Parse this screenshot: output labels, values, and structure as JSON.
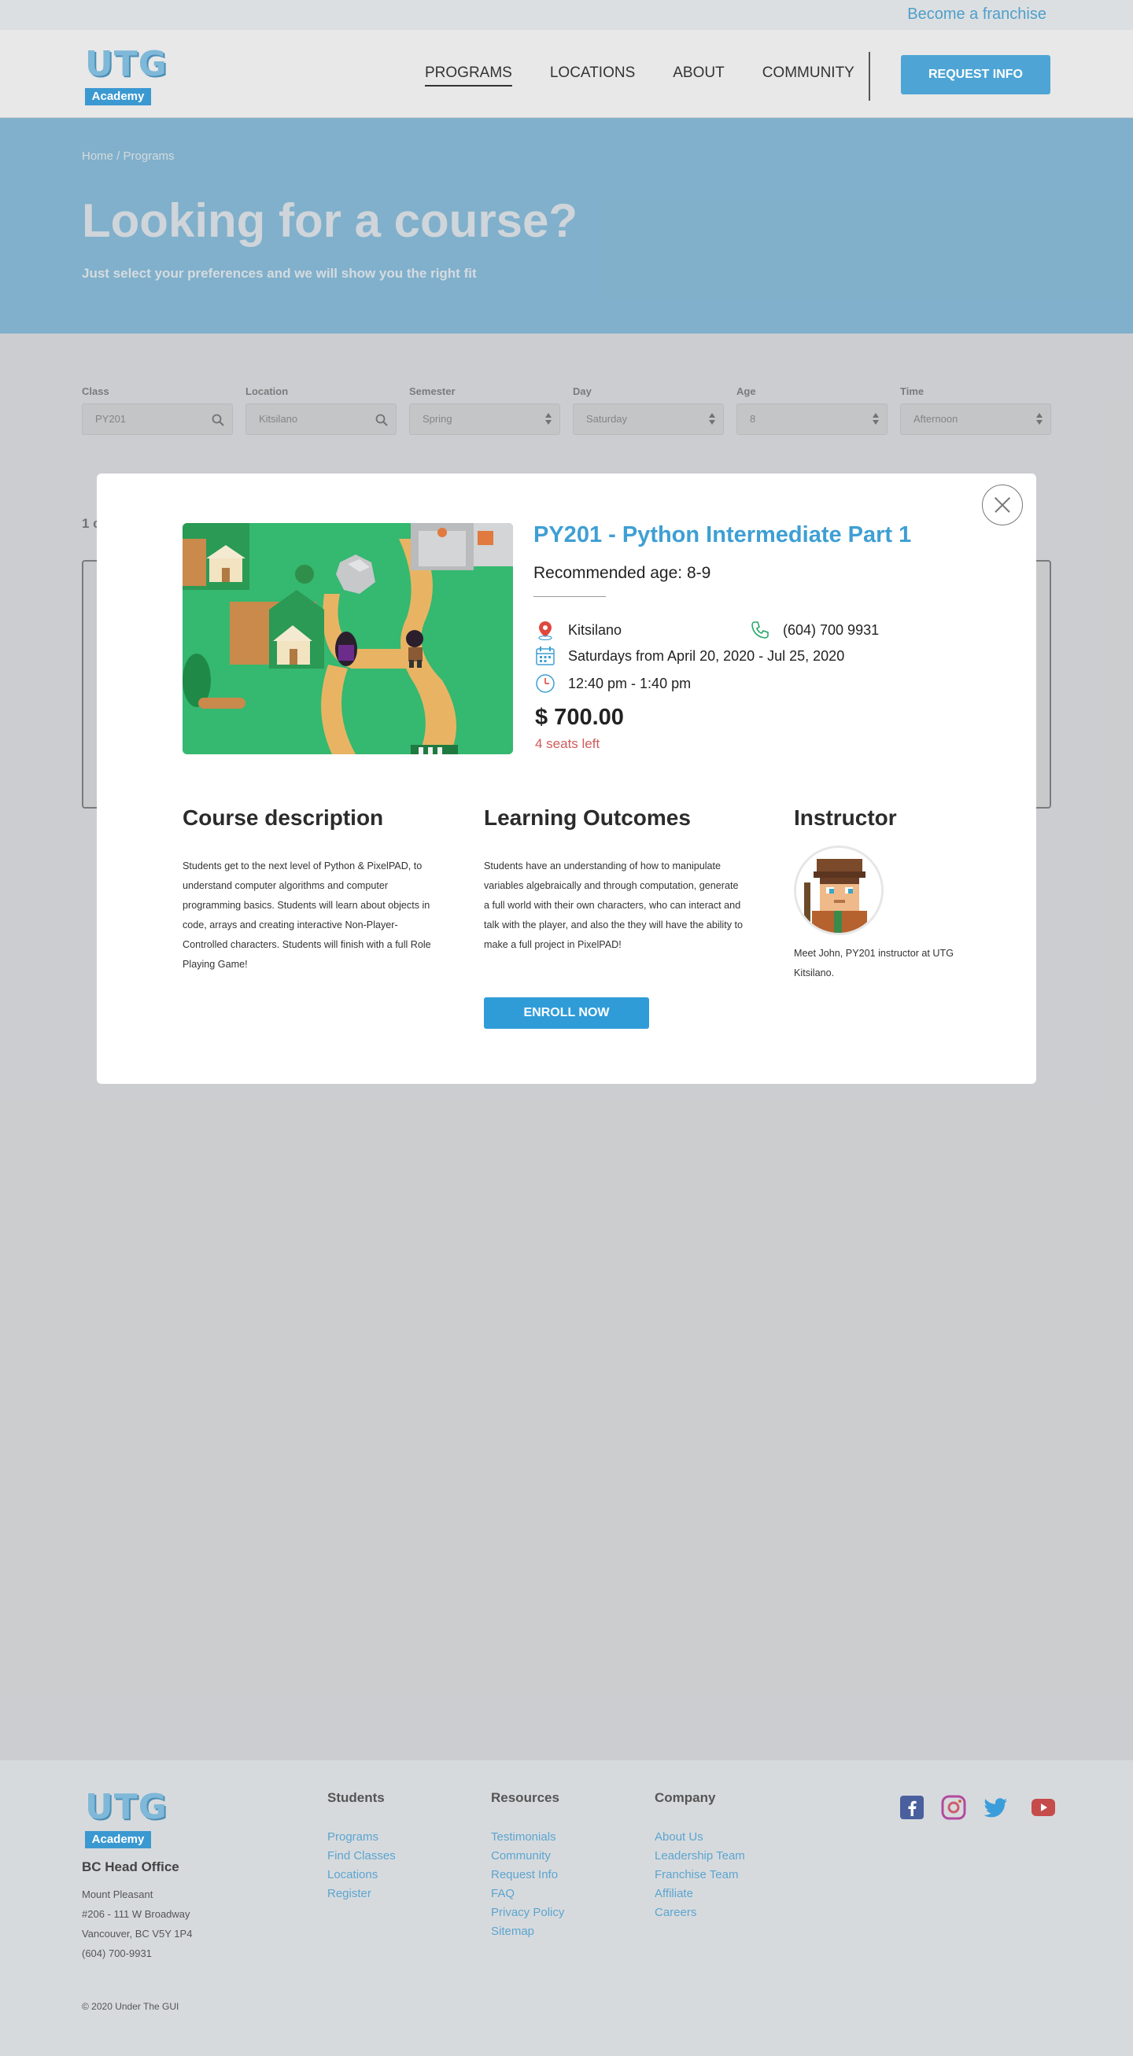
{
  "topbar": {
    "franchise_link": "Become a franchise"
  },
  "header": {
    "logo_letters": "UTG",
    "logo_tag": "Academy",
    "nav": [
      {
        "label": "PROGRAMS",
        "active": true
      },
      {
        "label": "LOCATIONS"
      },
      {
        "label": "ABOUT"
      },
      {
        "label": "COMMUNITY"
      }
    ],
    "request_button": "REQUEST INFO"
  },
  "hero": {
    "breadcrumb": "Home / Programs",
    "title": "Looking for a course?",
    "subtitle": "Just select your preferences and we will show you the right fit"
  },
  "filters": [
    {
      "label": "Class",
      "value": "PY201",
      "control": "search"
    },
    {
      "label": "Location",
      "value": "Kitsilano",
      "control": "search"
    },
    {
      "label": "Semester",
      "value": "Spring",
      "control": "select"
    },
    {
      "label": "Day",
      "value": "Saturday",
      "control": "select"
    },
    {
      "label": "Age",
      "value": "8",
      "control": "select"
    },
    {
      "label": "Time",
      "value": "Afternoon",
      "control": "select"
    }
  ],
  "results": {
    "count_text": "1 c"
  },
  "modal": {
    "title": "PY201 - Python Intermediate Part 1",
    "recommended_age": "Recommended age: 8-9",
    "location": "Kitsilano",
    "phone": "(604) 700 9931",
    "schedule": "Saturdays from April 20, 2020 - Jul 25, 2020",
    "time": "12:40 pm - 1:40 pm",
    "price": "$ 700.00",
    "seats_left": "4 seats left",
    "description_heading": "Course description",
    "description": "Students get to the next level of Python & PixelPAD, to understand computer algorithms and computer programming basics. Students will learn about objects in code, arrays and creating interactive Non-Player-Controlled characters. Students will finish with a full Role Playing Game!",
    "outcomes_heading": "Learning Outcomes",
    "outcomes": "Students have an understanding of how to manipulate variables algebraically and through computation, generate a full world with their own characters, who can interact and talk with the player, and also the they will have the ability to make a full project in PixelPAD!",
    "enroll_button": "ENROLL NOW",
    "instructor_heading": "Instructor",
    "instructor_text": "Meet John, PY201 instructor at UTG Kitsilano."
  },
  "footer": {
    "office_title": "BC Head Office",
    "address_lines": [
      "Mount Pleasant",
      "#206 - 111 W Broadway",
      "Vancouver, BC V5Y 1P4",
      "(604) 700-9931"
    ],
    "students": {
      "title": "Students",
      "links": [
        "Programs",
        "Find Classes",
        "Locations",
        "Register"
      ]
    },
    "resources": {
      "title": "Resources",
      "links": [
        "Testimonials",
        "Community",
        "Request Info",
        "FAQ",
        "Privacy Policy",
        "Sitemap"
      ]
    },
    "company": {
      "title": "Company",
      "links": [
        "About Us",
        "Leadership Team",
        "Franchise Team",
        "Affiliate",
        "Careers"
      ]
    },
    "copyright": "© 2020 Under The GUI",
    "social_icons": [
      "facebook-icon",
      "instagram-icon",
      "twitter-icon",
      "youtube-icon"
    ]
  },
  "colors": {
    "brand_blue": "#4fa4d3",
    "title_blue": "#3e9fd4",
    "alert_red": "#d05b5b",
    "button_blue": "#2f9cd8"
  }
}
